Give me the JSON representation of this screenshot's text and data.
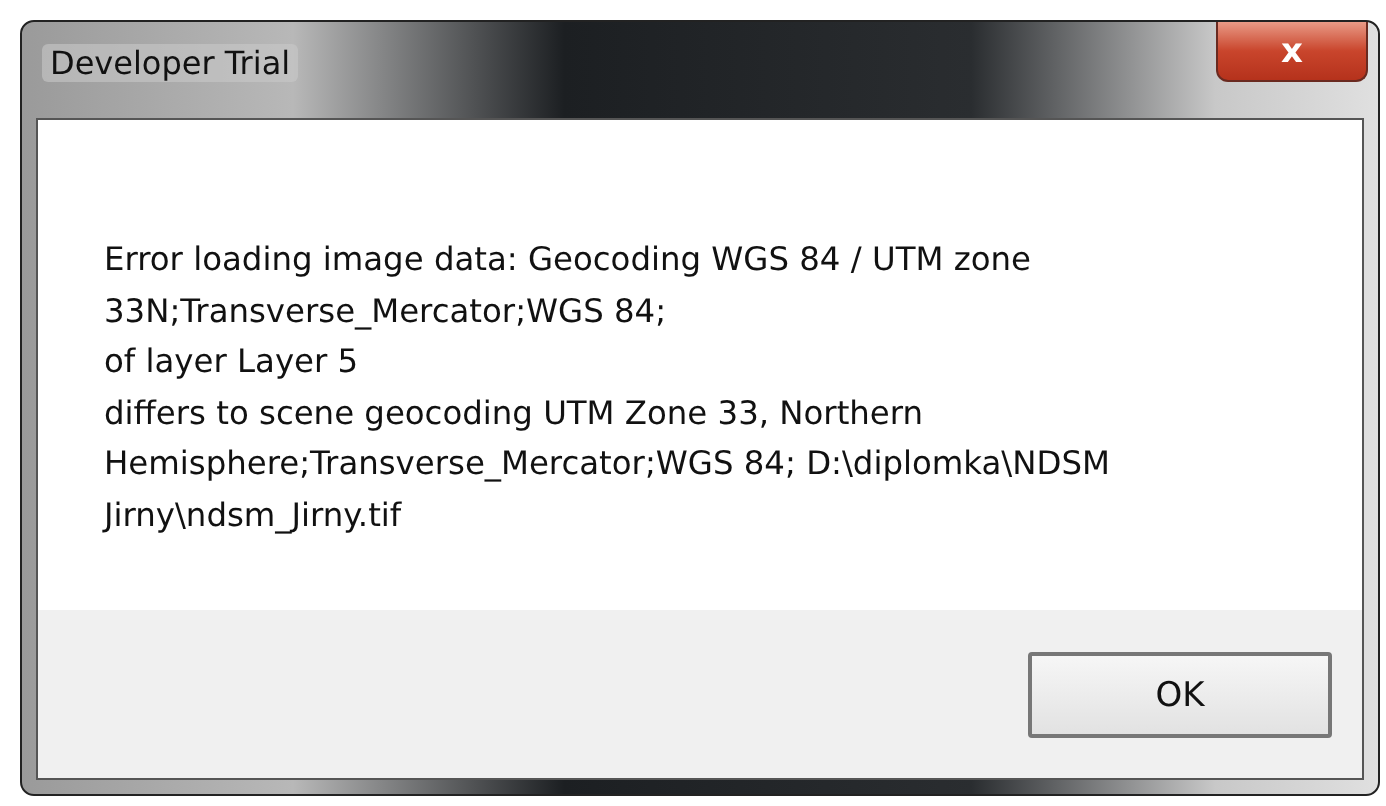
{
  "window": {
    "title": "Developer Trial",
    "close_label": "x"
  },
  "message": [
    "Error loading image data: Geocoding WGS 84 / UTM zone",
    "33N;Transverse_Mercator;WGS 84;",
    "of layer Layer 5",
    "differs to scene geocoding UTM Zone 33, Northern",
    "Hemisphere;Transverse_Mercator;WGS 84; D:\\diplomka\\NDSM",
    "Jirny\\ndsm_Jirny.tif"
  ],
  "buttons": [
    {
      "label": "OK"
    }
  ]
}
